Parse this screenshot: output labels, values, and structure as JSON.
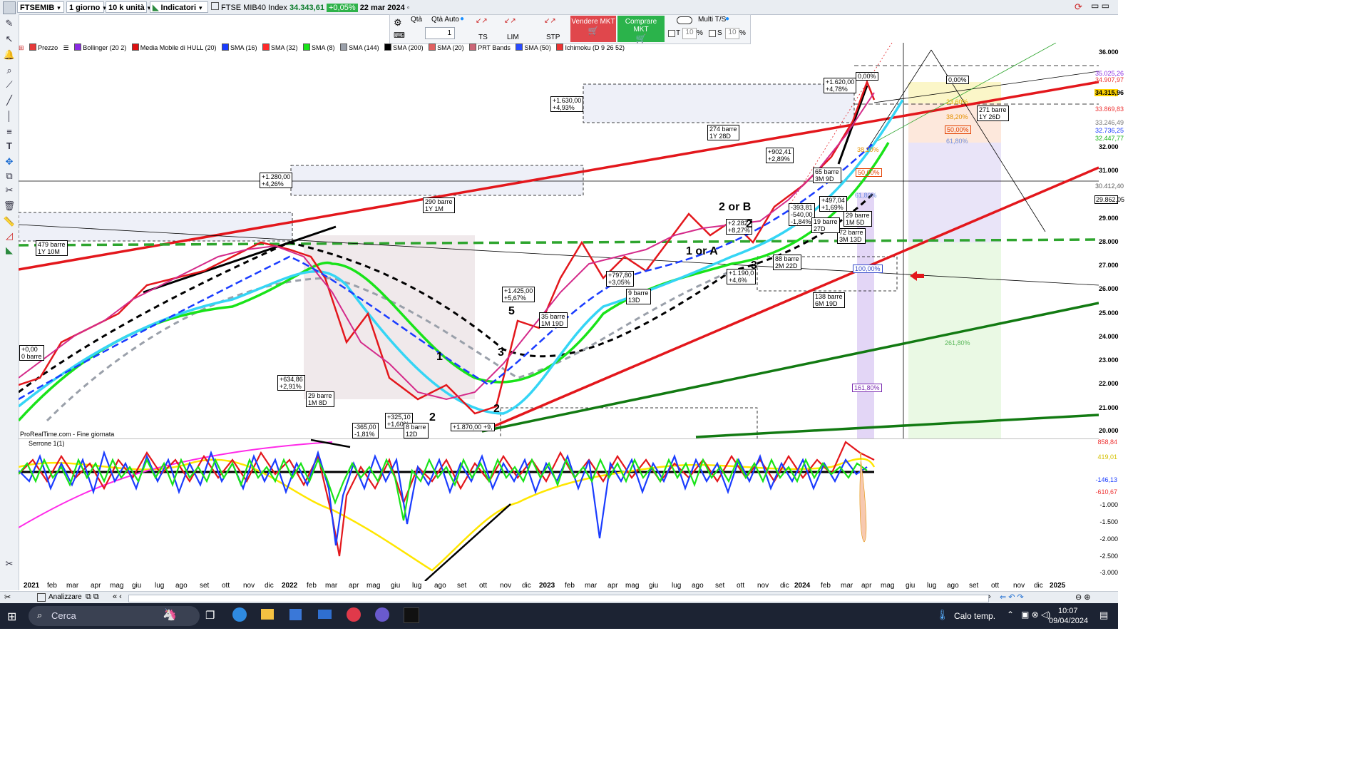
{
  "toolbar": {
    "symbol": "FTSEMIB",
    "timeframe": "1 giorno",
    "units": "10 k unità",
    "indicators": "Indicatori",
    "instrument_name": "FTSE MIB40 Index",
    "price": "34.343,61",
    "change": "+0,05%",
    "date": "22 mar 2024"
  },
  "order": {
    "qty_label": "Qtà",
    "qty_auto": "Qtà Auto",
    "qty_value": "1",
    "ts": "TS",
    "lim": "LIM",
    "stp": "STP",
    "sell": "Vendere MKT",
    "buy": "Comprare MKT",
    "multi": "Multi T/S",
    "t_label": "T",
    "t_value": "10",
    "s_label": "S",
    "s_value": "10",
    "pct": "%"
  },
  "indicators": [
    {
      "label": "Prezzo",
      "color": "#e63a3a"
    },
    {
      "label": "Bollinger (20 2)",
      "color": "#8a2be2"
    },
    {
      "label": "Media Mobile di HULL (20)",
      "color": "#d11"
    },
    {
      "label": "SMA (16)",
      "color": "#1a3cff"
    },
    {
      "label": "SMA (32)",
      "color": "#ff2a2a"
    },
    {
      "label": "SMA (8)",
      "color": "#19e319"
    },
    {
      "label": "SMA (144)",
      "color": "#9aa0aa"
    },
    {
      "label": "SMA (200)",
      "color": "#000"
    },
    {
      "label": "SMA (20)",
      "color": "#e06060"
    },
    {
      "label": "PRT Bands",
      "color": "#c67"
    },
    {
      "label": "SMA (50)",
      "color": "#2b4cff"
    },
    {
      "label": "Ichimoku (D 9 26 52)",
      "color": "#e33"
    }
  ],
  "chart_labels": {
    "watermark": "ProRealTime.com - Fine giornata",
    "oscillator": "Serrone 1(1)"
  },
  "price_axis": [
    "36.000",
    "35.000",
    "34.000",
    "33.000",
    "32.000",
    "31.000",
    "30.000",
    "29.000",
    "28.000",
    "27.000",
    "26.000",
    "25.000",
    "24.000",
    "23.000",
    "22.000",
    "21.000",
    "20.000"
  ],
  "price_tags": [
    {
      "text": "35.025,26",
      "color": "#8a2be2"
    },
    {
      "text": "34.907,97",
      "color": "#e33"
    },
    {
      "text": "34.315,96",
      "color": "#000",
      "bg": "#ffd400"
    },
    {
      "text": "33.869,83",
      "color": "#e33"
    },
    {
      "text": "33.246,49",
      "color": "#777"
    },
    {
      "text": "32.736,25",
      "color": "#1a3cff"
    },
    {
      "text": "32.447,77",
      "color": "#19b319"
    },
    {
      "text": "30.412,40",
      "color": "#555"
    },
    {
      "text": "29.862,05",
      "color": "#000"
    }
  ],
  "osc_axis": [
    "-1.000",
    "-1.500",
    "-2.000",
    "-2.500",
    "-3.000"
  ],
  "osc_tags": [
    {
      "text": "858,84",
      "color": "#e33"
    },
    {
      "text": "419,01",
      "color": "#d4c000"
    },
    {
      "text": "-146,13",
      "color": "#1a3cff"
    },
    {
      "text": "-610,67",
      "color": "#e33"
    }
  ],
  "x_axis": [
    "2021",
    "feb",
    "mar",
    "apr",
    "mag",
    "giu",
    "lug",
    "ago",
    "set",
    "ott",
    "nov",
    "dic",
    "2022",
    "feb",
    "mar",
    "apr",
    "mag",
    "giu",
    "lug",
    "ago",
    "set",
    "ott",
    "nov",
    "dic",
    "2023",
    "feb",
    "mar",
    "apr",
    "mag",
    "giu",
    "lug",
    "ago",
    "set",
    "ott",
    "nov",
    "dic",
    "2024",
    "feb",
    "mar",
    "apr",
    "mag",
    "giu",
    "lug",
    "ago",
    "set",
    "ott",
    "nov",
    "dic",
    "2025"
  ],
  "annotations": [
    {
      "text": "+1.620,00"
    },
    {
      "text": "+4,78%"
    },
    {
      "text": "+1.630,00"
    },
    {
      "text": "+4,93%"
    },
    {
      "text": "274 barre"
    },
    {
      "text": "1Y 28D"
    },
    {
      "text": "+1.280,00"
    },
    {
      "text": "+4,26%"
    },
    {
      "text": "290 barre"
    },
    {
      "text": "1Y 1M"
    },
    {
      "text": "479 barre"
    },
    {
      "text": "1Y 10M"
    },
    {
      "text": "271 barre"
    },
    {
      "text": "1Y 26D"
    },
    {
      "text": "+902,41"
    },
    {
      "text": "+2,89%"
    },
    {
      "text": "65 barre"
    },
    {
      "text": "3M 9D"
    },
    {
      "text": "+1.425,00"
    },
    {
      "text": "+5,67%"
    },
    {
      "text": "35 barre"
    },
    {
      "text": "1M 19D"
    },
    {
      "text": "+797,80"
    },
    {
      "text": "+3,05%"
    },
    {
      "text": "9 barre"
    },
    {
      "text": "13D"
    },
    {
      "text": "+634,86"
    },
    {
      "text": "+2,91%"
    },
    {
      "text": "29 barre"
    },
    {
      "text": "1M 8D"
    },
    {
      "text": "+325,10"
    },
    {
      "text": "+1,60%"
    },
    {
      "text": "8 barre"
    },
    {
      "text": "12D"
    },
    {
      "text": "-365,00"
    },
    {
      "text": "-1,81%"
    },
    {
      "text": "+1.870,00"
    },
    {
      "text": "+9,"
    },
    {
      "text": "+0,00"
    },
    {
      "text": "0 barre"
    },
    {
      "text": "138 barre"
    },
    {
      "text": "6M 19D"
    },
    {
      "text": "72 barre"
    },
    {
      "text": "3M 13D"
    },
    {
      "text": "+497,04"
    },
    {
      "text": "+1,69%"
    },
    {
      "text": "-393,81"
    },
    {
      "text": "-540,00"
    },
    {
      "text": "-1,84%"
    },
    {
      "text": "+1.190,0"
    },
    {
      "text": "+4,6%"
    },
    {
      "text": "+2.282"
    },
    {
      "text": "+8,27%"
    },
    {
      "text": "19 barre"
    },
    {
      "text": "27D"
    },
    {
      "text": "88 barre"
    },
    {
      "text": "2M 22D"
    },
    {
      "text": "29 barre"
    },
    {
      "text": "1M 5D"
    }
  ],
  "fibs": [
    "0,00%",
    "23,60%",
    "38,20%",
    "50,00%",
    "61,80%",
    "100,00%",
    "161,80%",
    "261,80%"
  ],
  "waves": [
    "1",
    "2",
    "3",
    "5",
    "2 or B",
    "1 or A",
    "3",
    "B"
  ],
  "taskbar": {
    "search": "Cerca",
    "weather": "Calo temp.",
    "time": "10:07",
    "date": "09/04/2024"
  },
  "bottom": {
    "analyze": "Analizzare"
  }
}
